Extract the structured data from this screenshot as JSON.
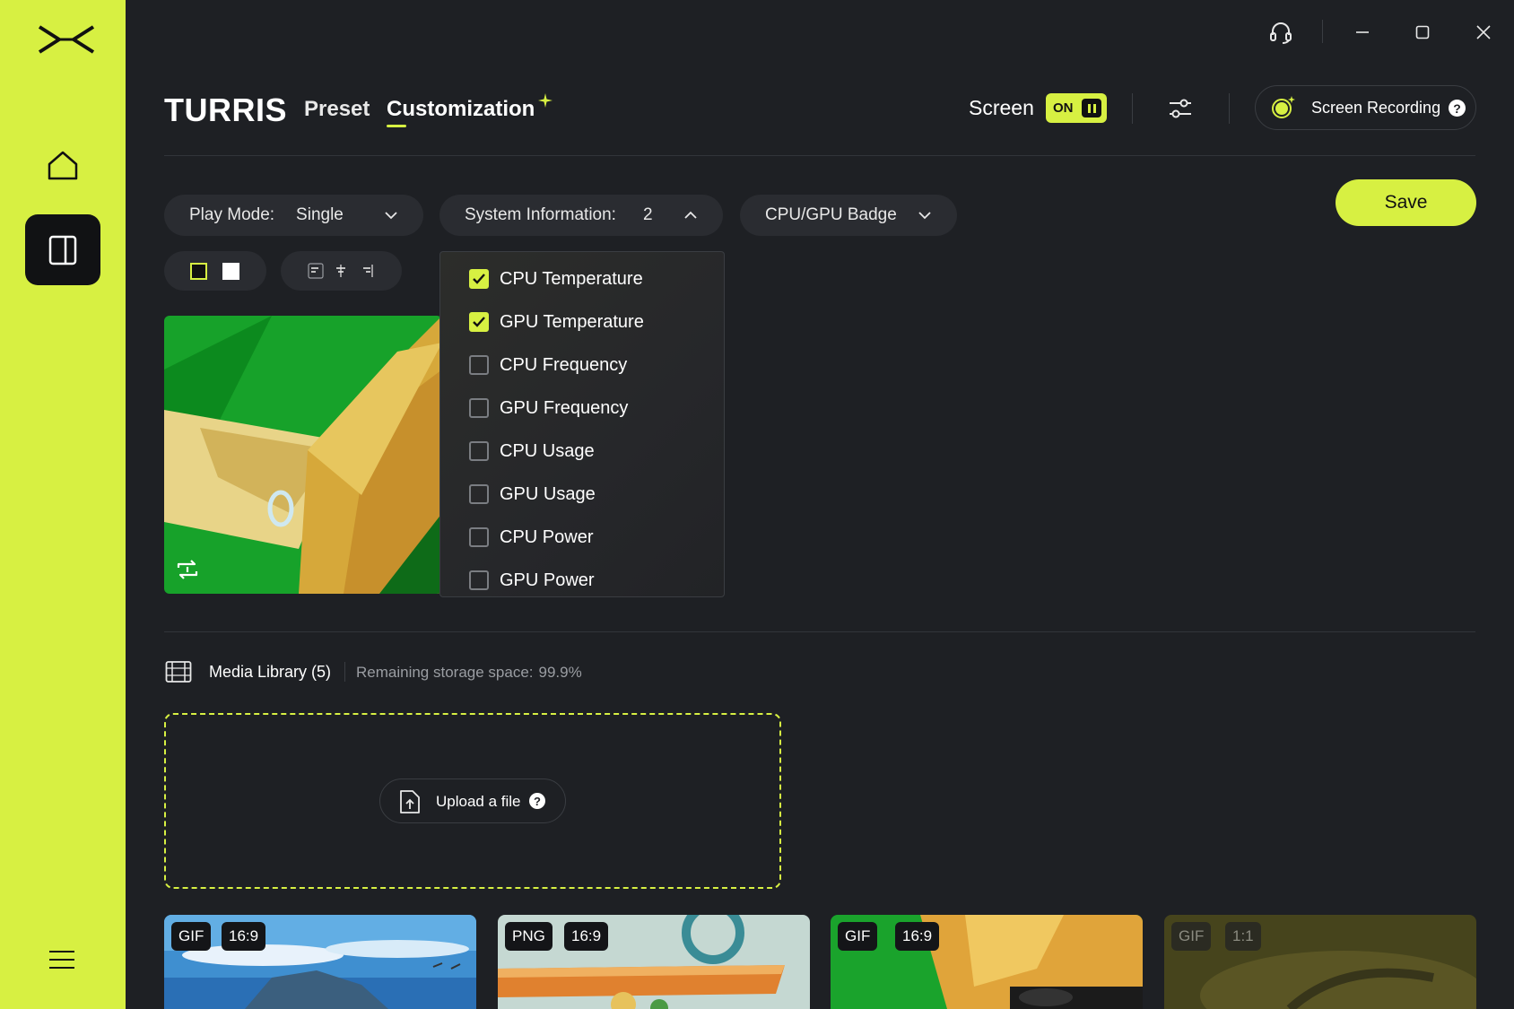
{
  "window": {
    "controls": [
      "headset-icon",
      "minimize-icon",
      "maximize-icon",
      "close-icon"
    ]
  },
  "sidebar": {
    "items": [
      "home-icon",
      "screen-panel-icon",
      "hamburger-menu-icon"
    ]
  },
  "header": {
    "brand": "TURRIS",
    "tabs": [
      {
        "label": "Preset",
        "active": false
      },
      {
        "label": "Customization",
        "active": true
      }
    ],
    "screen_label": "Screen",
    "screen_toggle": "ON",
    "screen_recording_label": "Screen Recording",
    "help_glyph": "?"
  },
  "controls": {
    "play_mode": {
      "label": "Play Mode:",
      "value": "Single"
    },
    "system_info": {
      "label": "System Information:",
      "value": "2"
    },
    "badge": {
      "value": "CPU/GPU Badge"
    },
    "save_label": "Save",
    "text_colors": [
      "#111111",
      "#ffffff"
    ],
    "align_icons": [
      "align-left-icon",
      "align-center-icon",
      "align-right-icon"
    ]
  },
  "system_info_options": [
    {
      "label": "CPU Temperature",
      "checked": true
    },
    {
      "label": "GPU Temperature",
      "checked": true
    },
    {
      "label": "CPU Frequency",
      "checked": false
    },
    {
      "label": "GPU Frequency",
      "checked": false
    },
    {
      "label": "CPU Usage",
      "checked": false
    },
    {
      "label": "GPU Usage",
      "checked": false
    },
    {
      "label": "CPU Power",
      "checked": false
    },
    {
      "label": "GPU Power",
      "checked": false
    }
  ],
  "media_library": {
    "title": "Media Library (5)",
    "storage_label": "Remaining storage space:",
    "storage_value": "99.9%",
    "upload_label": "Upload a file",
    "items": [
      {
        "format": "GIF",
        "ratio": "16:9"
      },
      {
        "format": "PNG",
        "ratio": "16:9"
      },
      {
        "format": "GIF",
        "ratio": "16:9"
      },
      {
        "format": "GIF",
        "ratio": "1:1"
      }
    ]
  },
  "colors": {
    "accent": "#d7f042",
    "background": "#1e2024",
    "panel": "#2a2c31"
  }
}
